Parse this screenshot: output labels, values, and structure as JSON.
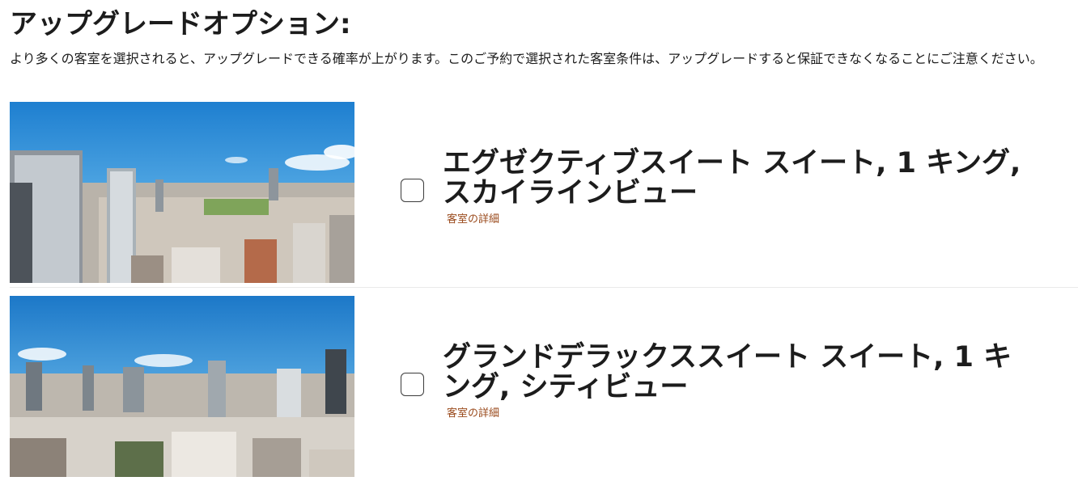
{
  "page": {
    "title": "アップグレードオプション:",
    "intro": "より多くの客室を選択されると、アップグレードできる確率が上がります。このご予約で選択された客室条件は、アップグレードすると保証できなくなることにご注意ください。"
  },
  "options": [
    {
      "room_name": "エグゼクティブスイート スイート, 1 キング, スカイラインビュー",
      "details_label": "客室の詳細",
      "checked": false
    },
    {
      "room_name": "グランドデラックススイート スイート, 1 キング, シティビュー",
      "details_label": "客室の詳細",
      "checked": false
    }
  ],
  "colors": {
    "link": "#9a4a1c",
    "text": "#1c1c1c",
    "sky": "#2f8fd8"
  }
}
